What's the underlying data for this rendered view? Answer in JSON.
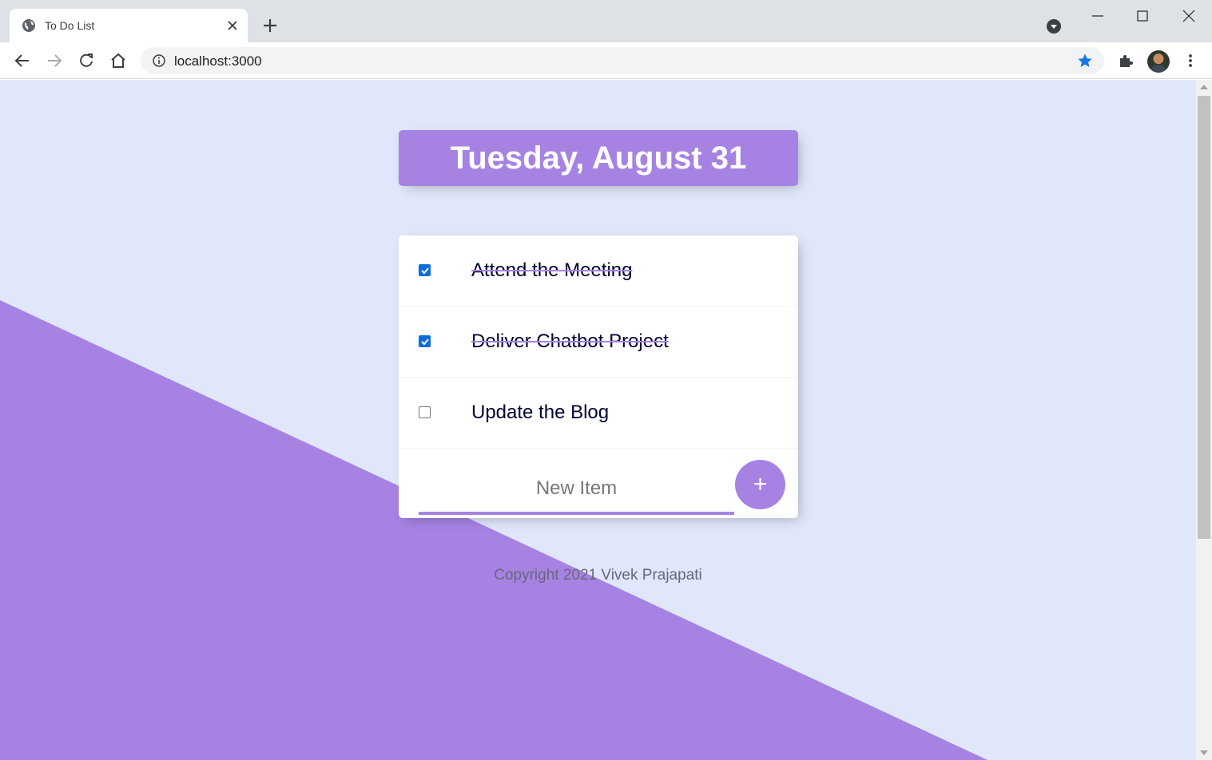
{
  "browser": {
    "tab_title": "To Do List",
    "url": "localhost:3000"
  },
  "colors": {
    "accent": "#a683e3",
    "page_background": "#e1e7fb",
    "checkbox_checked": "#0b6cdd"
  },
  "page": {
    "heading": "Tuesday, August 31",
    "items": [
      {
        "label": "Attend the Meeting",
        "checked": true
      },
      {
        "label": "Deliver Chatbot Project",
        "checked": true
      },
      {
        "label": "Update the Blog",
        "checked": false
      }
    ],
    "new_item_placeholder": "New Item",
    "add_button_label": "+",
    "footer": "Copyright 2021 Vivek Prajapati"
  }
}
